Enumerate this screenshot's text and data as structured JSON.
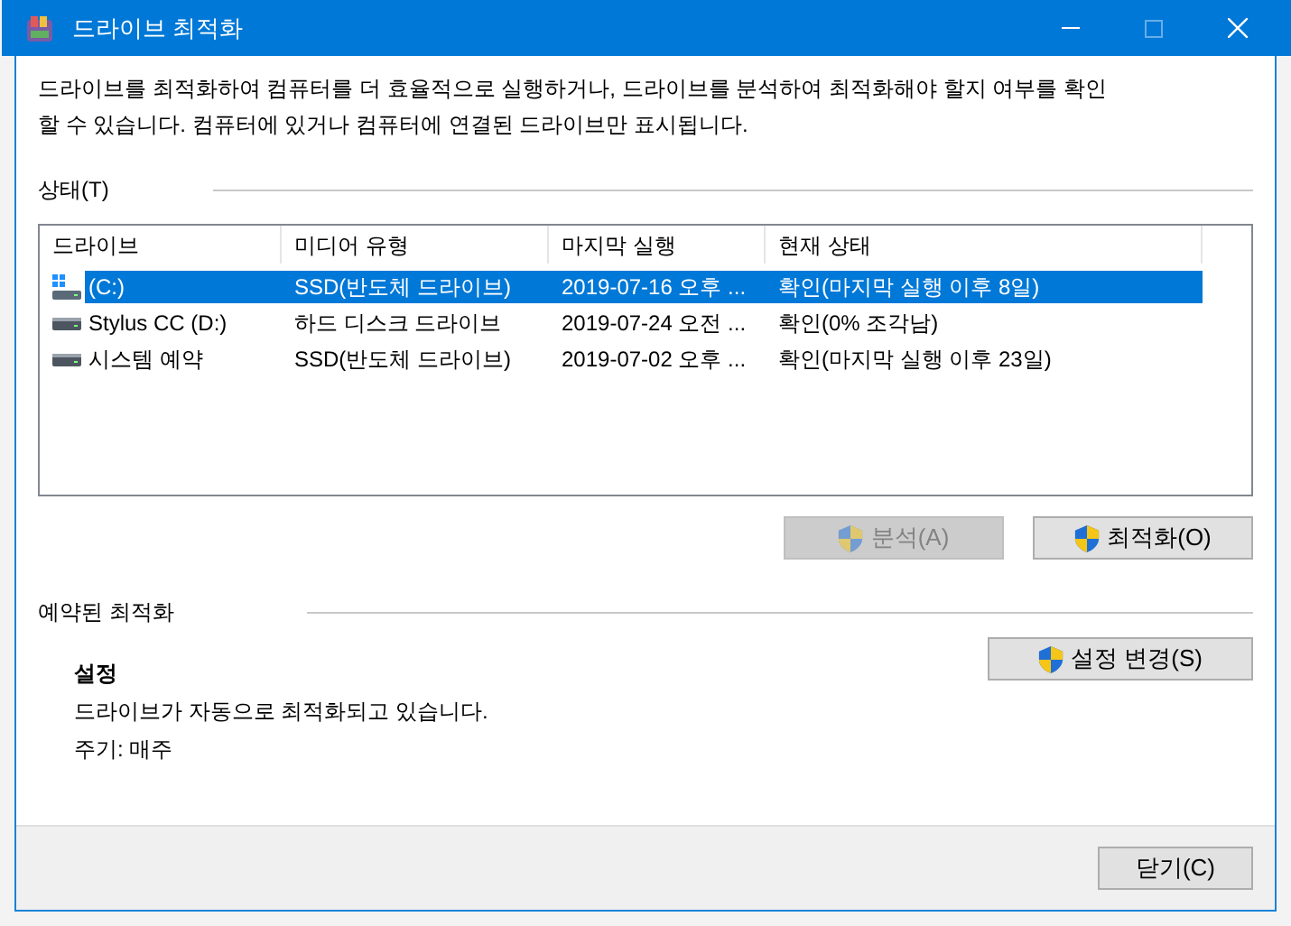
{
  "window": {
    "title": "드라이브 최적화"
  },
  "description": "드라이브를 최적화하여 컴퓨터를 더 효율적으로 실행하거나, 드라이브를 분석하여 최적화해야 할지 여부를 확인할 수 있습니다. 컴퓨터에 있거나 컴퓨터에 연결된 드라이브만 표시됩니다.",
  "status_section": {
    "title": "상태(T)",
    "table": {
      "columns": [
        "드라이브",
        "미디어 유형",
        "마지막 실행",
        "현재 상태"
      ],
      "rows": [
        {
          "kind": "system",
          "selected": true,
          "cells": [
            "(C:)",
            "SSD(반도체 드라이브)",
            "2019-07-16 오후 ...",
            "확인(마지막 실행 이후 8일)"
          ]
        },
        {
          "kind": "drive",
          "selected": false,
          "cells": [
            "Stylus CC (D:)",
            "하드 디스크 드라이브",
            "2019-07-24 오전 ...",
            "확인(0% 조각남)"
          ]
        },
        {
          "kind": "drive",
          "selected": false,
          "cells": [
            "시스템 예약",
            "SSD(반도체 드라이브)",
            "2019-07-02 오후 ...",
            "확인(마지막 실행 이후 23일)"
          ]
        }
      ]
    },
    "buttons": [
      {
        "label": "분석(A)",
        "disabled": true
      },
      {
        "label": "최적화(O)",
        "disabled": false
      }
    ]
  },
  "scheduled_section": {
    "title": "예약된 최적화",
    "heading": "설정",
    "status": "드라이브가 자동으로 최적화되고 있습니다.",
    "frequency": "주기: 매주",
    "button": {
      "label": "설정 변경(S)",
      "disabled": false
    }
  },
  "footer": {
    "close_button": "닫기(C)"
  }
}
